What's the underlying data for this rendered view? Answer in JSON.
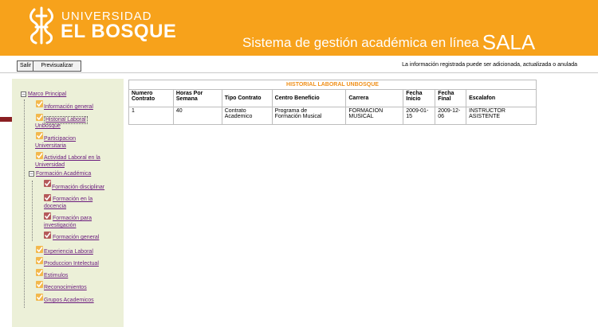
{
  "header": {
    "brand_line1": "UNIVERSIDAD",
    "brand_line2": "EL BOSQUE",
    "system_title": "Sistema de gestión académica en línea",
    "system_name": "SALA",
    "background_color": "#f7a21b"
  },
  "toolbar": {
    "exit_label": "Salir",
    "preview_label": "Previsualizar",
    "notice": "La información registrada puede ser adicionada, actualizada o anulada"
  },
  "sidebar": {
    "root": "Marco Principal",
    "items": [
      {
        "label": "Información general"
      },
      {
        "label_line1": "Historial Laboral",
        "label_line2": "Unbosque"
      },
      {
        "label_line1": "Participacion",
        "label_line2": "Universitaria"
      },
      {
        "label_line1": "Actividad Laboral en la",
        "label_line2": "Universidad"
      }
    ],
    "formacion": {
      "label": "Formación Académica",
      "children": [
        {
          "label": "Formación disciplinar"
        },
        {
          "label_line1": "Formación en la",
          "label_line2": "docencia"
        },
        {
          "label_line1": "Formación para",
          "label_line2": "investigación"
        },
        {
          "label": "Formación general"
        }
      ]
    },
    "items_after": [
      {
        "label": "Experiencia Laboral"
      },
      {
        "label": "Produccion Intelectual"
      },
      {
        "label": "Estimulos"
      },
      {
        "label": "Reconocimientos"
      },
      {
        "label": "Grupos Academicos"
      }
    ]
  },
  "table": {
    "caption": "HISTORIAL LABORAL UNBOSQUE",
    "headers": [
      {
        "line1": "Numero",
        "line2": "Contrato"
      },
      {
        "line1": "Horas Por",
        "line2": "Semana"
      },
      {
        "line1": "Tipo Contrato",
        "line2": ""
      },
      {
        "line1": "Centro Beneficio",
        "line2": ""
      },
      {
        "line1": "Carrera",
        "line2": ""
      },
      {
        "line1": "Fecha",
        "line2": "Inicio"
      },
      {
        "line1": "Fecha",
        "line2": "Final"
      },
      {
        "line1": "Escalafon",
        "line2": ""
      }
    ],
    "rows": [
      {
        "numero": "1",
        "horas": "40",
        "tipo_line1": "Contrato",
        "tipo_line2": "Academico",
        "centro_line1": "Programa de",
        "centro_line2": "Formación Musical",
        "carrera_line1": "FORMACION",
        "carrera_line2": "MUSICAL",
        "inicio_line1": "2009-01-",
        "inicio_line2": "15",
        "final_line1": "2009-12-",
        "final_line2": "06",
        "escalafon_line1": "INSTRUCTOR",
        "escalafon_line2": "ASISTENTE"
      }
    ]
  }
}
